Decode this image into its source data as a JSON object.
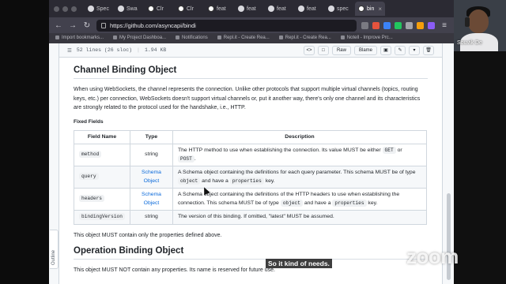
{
  "tabs": [
    {
      "label": "Spec",
      "active": false
    },
    {
      "label": "Swa",
      "active": false
    },
    {
      "label": "Clr",
      "active": false
    },
    {
      "label": "Clr",
      "active": false
    },
    {
      "label": "feat",
      "active": false
    },
    {
      "label": "feat",
      "active": false
    },
    {
      "label": "feat",
      "active": false
    },
    {
      "label": "feat",
      "active": false
    },
    {
      "label": "spec",
      "active": false
    },
    {
      "label": "bin",
      "active": true
    }
  ],
  "url": "https://github.com/asyncapi/bindi",
  "bookmarks": [
    "Import bookmarks...",
    "My Project Dashboa...",
    "Notifications",
    "Repl.it - Create Rea...",
    "Repl.it - Create Rea...",
    "Notell - Improve Prc..."
  ],
  "file_header": {
    "lines": "52 lines (26 sloc)",
    "size": "1.94 KB",
    "raw": "Raw",
    "blame": "Blame"
  },
  "doc": {
    "heading1": "Channel Binding Object",
    "para1": "When using WebSockets, the channel represents the connection. Unlike other protocols that support multiple virtual channels (topics, routing keys, etc.) per connection, WebSockets doesn't support virtual channels or, put it another way, there's only one channel and its characteristics are strongly related to the protocol used for the handshake, i.e., HTTP.",
    "fixed_fields": "Fixed Fields",
    "table": {
      "headers": [
        "Field Name",
        "Type",
        "Description"
      ],
      "rows": [
        {
          "name": "method",
          "type": "string",
          "type_link": false,
          "desc_a": "The HTTP method to use when establishing the connection. Its value MUST be either ",
          "code1": "GET",
          "desc_b": " or ",
          "code2": "POST",
          "desc_c": "."
        },
        {
          "name": "query",
          "type": "Schema Object",
          "type_link": true,
          "desc_a": "A Schema object containing the definitions for each query parameter. This schema MUST be of type ",
          "code1": "object",
          "desc_b": " and have a ",
          "code2": "properties",
          "desc_c": " key."
        },
        {
          "name": "headers",
          "type": "Schema Object",
          "type_link": true,
          "desc_a": "A Schema object containing the definitions of the HTTP headers to use when establishing the connection. This schema MUST be of type ",
          "code1": "object",
          "desc_b": " and have a ",
          "code2": "properties",
          "desc_c": " key."
        },
        {
          "name": "bindingVersion",
          "type": "string",
          "type_link": false,
          "desc_a": "The version of this binding. If omitted, \"latest\" MUST be assumed.",
          "code1": "",
          "desc_b": "",
          "code2": "",
          "desc_c": ""
        }
      ]
    },
    "para2": "This object MUST contain only the properties defined above.",
    "heading2": "Operation Binding Object",
    "para3": "This object MUST NOT contain any properties. Its name is reserved for future use."
  },
  "outline_tab": "Outline",
  "caption": "So it kind of needs.",
  "participant_name": "Souvik De",
  "zoom_logo": "zoom"
}
